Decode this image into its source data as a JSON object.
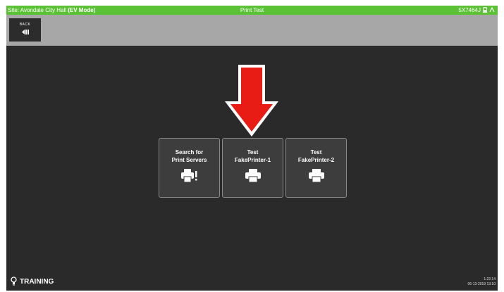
{
  "titlebar": {
    "location": "Site: Avondale City Hall",
    "mode": "(EV Mode)",
    "screen_title": "Print Test",
    "station_id": "5X7464J",
    "background_color": "#5bc236"
  },
  "toolbar": {
    "back_label": "BACK",
    "back_icon": "back-arrow-icon"
  },
  "tiles": [
    {
      "line1": "Search for",
      "line2": "Print Servers",
      "icon": "printer-search-icon"
    },
    {
      "line1": "Test",
      "line2": "FakePrinter-1",
      "icon": "printer-icon"
    },
    {
      "line1": "Test",
      "line2": "FakePrinter-2",
      "icon": "printer-icon"
    }
  ],
  "callout": {
    "icon": "red-down-arrow",
    "color": "#e81c14"
  },
  "footer": {
    "training_label": "TRAINING",
    "training_icon": "lightbulb-icon",
    "time": "1:22:14",
    "date": "06-13-2019 13:10"
  }
}
